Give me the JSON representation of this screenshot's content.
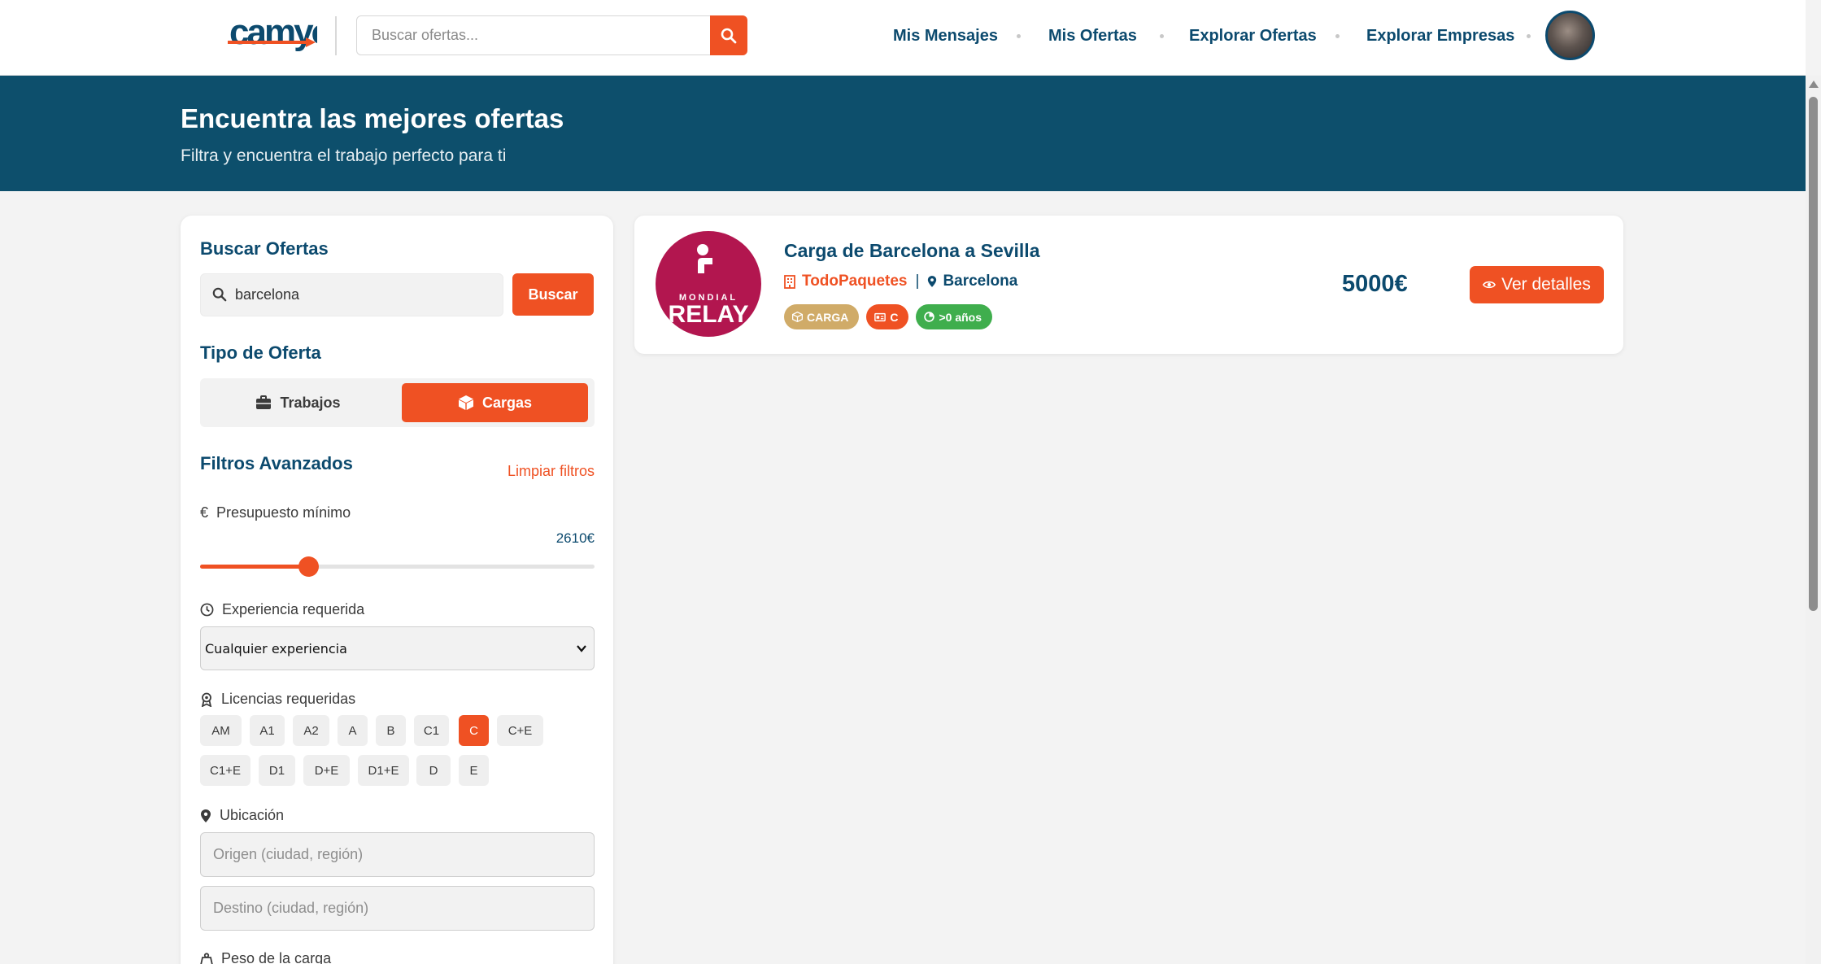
{
  "header": {
    "logo_text": "camyo",
    "search_placeholder": "Buscar ofertas...",
    "nav": [
      "Mis Mensajes",
      "Mis Ofertas",
      "Explorar Ofertas",
      "Explorar Empresas"
    ]
  },
  "hero": {
    "title": "Encuentra las mejores ofertas",
    "subtitle": "Filtra y encuentra el trabajo perfecto para ti"
  },
  "sidebar": {
    "search_title": "Buscar Ofertas",
    "search_value": "barcelona",
    "search_button": "Buscar",
    "offer_type_title": "Tipo de Oferta",
    "offer_types": [
      {
        "label": "Trabajos",
        "icon": "briefcase-icon",
        "active": false
      },
      {
        "label": "Cargas",
        "icon": "box-icon",
        "active": true
      }
    ],
    "advanced_title": "Filtros Avanzados",
    "clear_filters": "Limpiar filtros",
    "budget_label": "Presupuesto mínimo",
    "budget_value": "2610€",
    "budget_fraction": 0.275,
    "experience_label": "Experiencia requerida",
    "experience_selected": "Cualquier experiencia",
    "licenses_label": "Licencias requeridas",
    "licenses": [
      "AM",
      "A1",
      "A2",
      "A",
      "B",
      "C1",
      "C",
      "C+E",
      "C1+E",
      "D1",
      "D+E",
      "D1+E",
      "D",
      "E"
    ],
    "licenses_active": [
      "C"
    ],
    "location_label": "Ubicación",
    "origin_placeholder": "Origen (ciudad, región)",
    "destination_placeholder": "Destino (ciudad, región)",
    "weight_label": "Peso de la carga"
  },
  "results": [
    {
      "logo_top": "MONDIAL",
      "logo_bottom": "RELAY",
      "title": "Carga de Barcelona a Sevilla",
      "company": "TodoPaquetes",
      "city": "Barcelona",
      "tags": [
        {
          "label": "CARGA",
          "icon": "box-icon",
          "color": "#d0ab68"
        },
        {
          "label": "C",
          "icon": "id-card-icon",
          "color": "#ef5123"
        },
        {
          "label": ">0 años",
          "icon": "experience-icon",
          "color": "#3fae4d"
        }
      ],
      "price": "5000€",
      "details_button": "Ver detalles"
    }
  ],
  "colors": {
    "accent": "#ef5123",
    "primary": "#0c4a6e",
    "hero": "#0d4f6c"
  }
}
